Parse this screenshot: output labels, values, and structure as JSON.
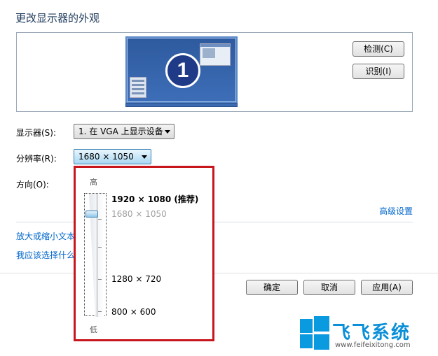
{
  "page": {
    "title": "更改显示器的外观"
  },
  "preview": {
    "monitor_number": "1"
  },
  "buttons": {
    "detect": "检测(C)",
    "identify": "识别(I)",
    "ok": "确定",
    "cancel": "取消",
    "apply": "应用(A)"
  },
  "display": {
    "label": "显示器(S):",
    "value": "1. 在 VGA 上显示设备"
  },
  "resolution": {
    "label": "分辨率(R):",
    "value": "1680 × 1050"
  },
  "orientation": {
    "label": "方向(O):"
  },
  "links": {
    "advanced": "高级设置",
    "text_size": "放大或缩小文本",
    "which": "我应该选择什么"
  },
  "popup": {
    "high": "高",
    "low": "低",
    "items": [
      "1920 × 1080 (推荐)",
      "1680 × 1050",
      "1280 × 720",
      "800 × 600"
    ]
  },
  "watermark": {
    "brand": "飞飞系统",
    "url": "www.feifeixitong.com",
    "color": "#0a9ae0"
  }
}
